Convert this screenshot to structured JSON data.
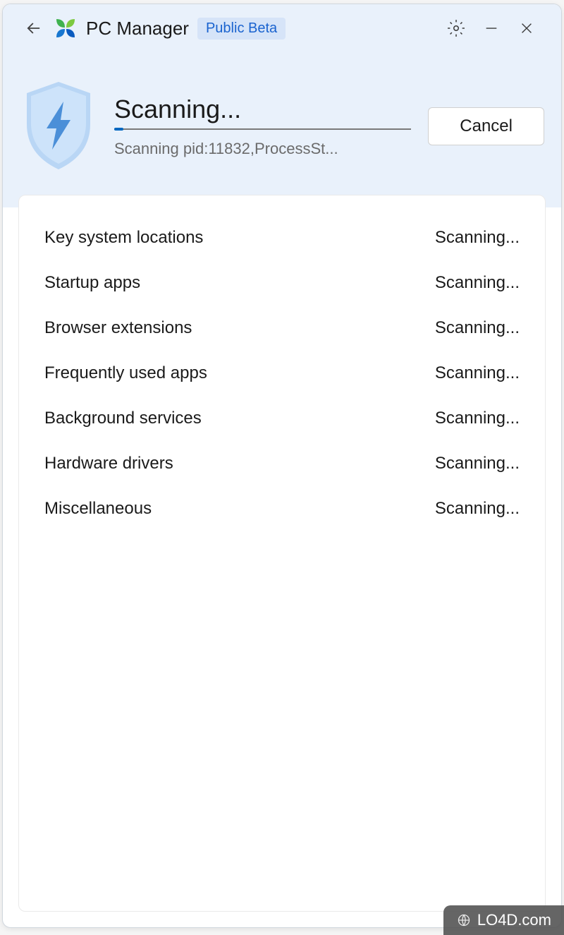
{
  "header": {
    "title": "PC Manager",
    "badge": "Public Beta"
  },
  "scan": {
    "title": "Scanning...",
    "detail": "Scanning pid:11832,ProcessSt...",
    "cancel_label": "Cancel"
  },
  "items": [
    {
      "label": "Key system locations",
      "status": "Scanning..."
    },
    {
      "label": "Startup apps",
      "status": "Scanning..."
    },
    {
      "label": "Browser extensions",
      "status": "Scanning..."
    },
    {
      "label": "Frequently used apps",
      "status": "Scanning..."
    },
    {
      "label": "Background services",
      "status": "Scanning..."
    },
    {
      "label": "Hardware drivers",
      "status": "Scanning..."
    },
    {
      "label": "Miscellaneous",
      "status": "Scanning..."
    }
  ],
  "watermark": "LO4D.com"
}
